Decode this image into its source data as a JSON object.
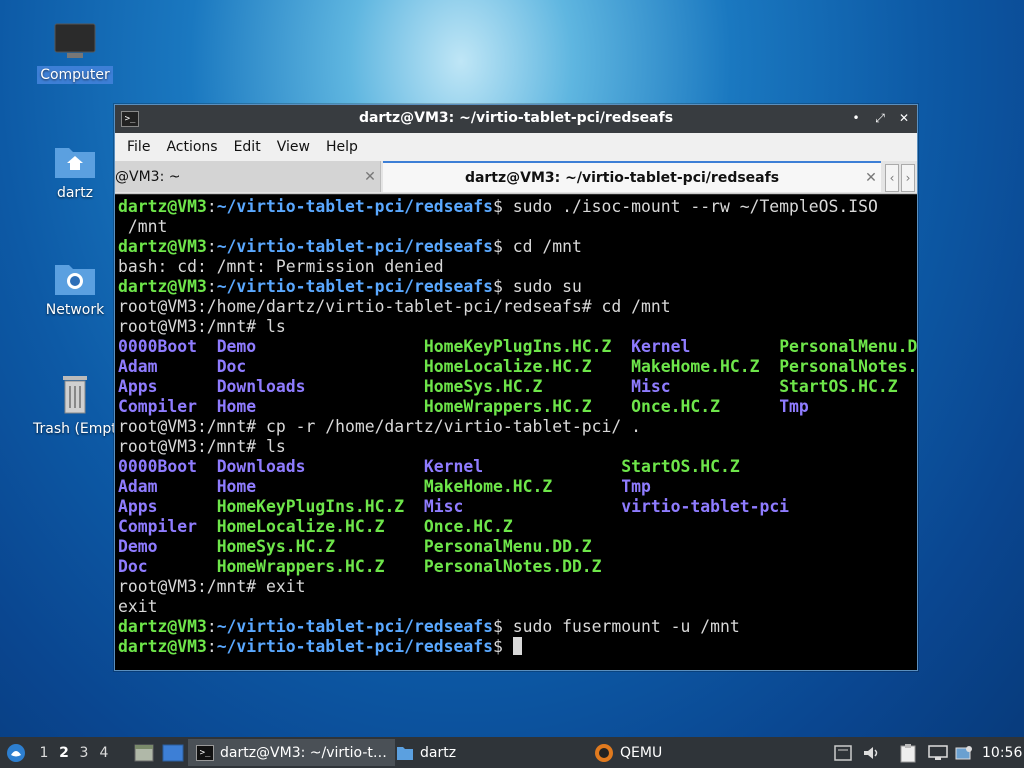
{
  "desktop": {
    "icons": [
      {
        "label": "Computer"
      },
      {
        "label": "dartz"
      },
      {
        "label": "Network"
      },
      {
        "label": "Trash (Empty)"
      }
    ]
  },
  "window": {
    "title": "dartz@VM3: ~/virtio-tablet-pci/redseafs",
    "menu": [
      "File",
      "Actions",
      "Edit",
      "View",
      "Help"
    ],
    "tabs": [
      {
        "label": "@VM3: ~",
        "close": "✕"
      },
      {
        "label": "dartz@VM3: ~/virtio-tablet-pci/redseafs",
        "close": "✕"
      }
    ],
    "tab_prev": "‹",
    "tab_next": "›"
  },
  "terminal": {
    "user_prompt": "dartz@VM3",
    "path": "~/virtio-tablet-pci/redseafs",
    "lines": [
      {
        "type": "cmd",
        "cmd": " sudo ./isoc-mount --rw ~/TempleOS.ISO"
      },
      {
        "type": "out",
        "text": " /mnt"
      },
      {
        "type": "cmd",
        "cmd": " cd /mnt"
      },
      {
        "type": "out",
        "text": "bash: cd: /mnt: Permission denied"
      },
      {
        "type": "cmd",
        "cmd": " sudo su"
      },
      {
        "type": "out",
        "text": "root@VM3:/home/dartz/virtio-tablet-pci/redseafs# cd /mnt"
      },
      {
        "type": "out",
        "text": "root@VM3:/mnt# ls"
      },
      {
        "type": "ls",
        "cells": [
          [
            "0000Boot",
            "d"
          ],
          [
            "Demo",
            "d"
          ],
          [
            "HomeKeyPlugIns.HC.Z",
            "f"
          ],
          [
            "Kernel",
            "d"
          ],
          [
            "PersonalMenu.DD.Z",
            "f"
          ]
        ]
      },
      {
        "type": "ls",
        "cells": [
          [
            "Adam",
            "d"
          ],
          [
            "Doc",
            "d"
          ],
          [
            "HomeLocalize.HC.Z",
            "f"
          ],
          [
            "MakeHome.HC.Z",
            "f"
          ],
          [
            "PersonalNotes.DD.Z",
            "f"
          ]
        ]
      },
      {
        "type": "ls",
        "cells": [
          [
            "Apps",
            "d"
          ],
          [
            "Downloads",
            "d"
          ],
          [
            "HomeSys.HC.Z",
            "f"
          ],
          [
            "Misc",
            "d"
          ],
          [
            "StartOS.HC.Z",
            "f"
          ]
        ]
      },
      {
        "type": "ls",
        "cells": [
          [
            "Compiler",
            "d"
          ],
          [
            "Home",
            "d"
          ],
          [
            "HomeWrappers.HC.Z",
            "f"
          ],
          [
            "Once.HC.Z",
            "f"
          ],
          [
            "Tmp",
            "d"
          ]
        ]
      },
      {
        "type": "out",
        "text": "root@VM3:/mnt# cp -r /home/dartz/virtio-tablet-pci/ ."
      },
      {
        "type": "out",
        "text": "root@VM3:/mnt# ls"
      },
      {
        "type": "ls2",
        "cells": [
          [
            "0000Boot",
            "d"
          ],
          [
            "Downloads",
            "d"
          ],
          [
            "Kernel",
            "d"
          ],
          [
            "StartOS.HC.Z",
            "f"
          ]
        ]
      },
      {
        "type": "ls2",
        "cells": [
          [
            "Adam",
            "d"
          ],
          [
            "Home",
            "d"
          ],
          [
            "MakeHome.HC.Z",
            "f"
          ],
          [
            "Tmp",
            "d"
          ]
        ]
      },
      {
        "type": "ls2",
        "cells": [
          [
            "Apps",
            "d"
          ],
          [
            "HomeKeyPlugIns.HC.Z",
            "f"
          ],
          [
            "Misc",
            "d"
          ],
          [
            "virtio-tablet-pci",
            "d"
          ]
        ]
      },
      {
        "type": "ls2",
        "cells": [
          [
            "Compiler",
            "d"
          ],
          [
            "HomeLocalize.HC.Z",
            "f"
          ],
          [
            "Once.HC.Z",
            "f"
          ]
        ]
      },
      {
        "type": "ls2",
        "cells": [
          [
            "Demo",
            "d"
          ],
          [
            "HomeSys.HC.Z",
            "f"
          ],
          [
            "PersonalMenu.DD.Z",
            "f"
          ]
        ]
      },
      {
        "type": "ls2",
        "cells": [
          [
            "Doc",
            "d"
          ],
          [
            "HomeWrappers.HC.Z",
            "f"
          ],
          [
            "PersonalNotes.DD.Z",
            "f"
          ]
        ]
      },
      {
        "type": "out",
        "text": "root@VM3:/mnt# exit"
      },
      {
        "type": "out",
        "text": "exit"
      },
      {
        "type": "cmd",
        "cmd": " sudo fusermount -u /mnt"
      },
      {
        "type": "cmd",
        "cmd": " ",
        "cursor": true
      }
    ]
  },
  "taskbar": {
    "workspaces": [
      "1",
      "2",
      "3",
      "4"
    ],
    "current_workspace": "2",
    "tasks": [
      {
        "label": "dartz@VM3: ~/virtio-t…",
        "icon": "terminal-icon"
      },
      {
        "label": "dartz",
        "icon": "folder-icon"
      },
      {
        "label": "QEMU",
        "icon": "qemu-icon"
      }
    ],
    "clock": "10:56"
  },
  "colors": {
    "prompt_user": "#6ee64a",
    "prompt_path": "#5aa8ff",
    "ls_dir": "#8f7cff",
    "ls_file": "#6ee64a",
    "accent": "#3d7fd6"
  }
}
